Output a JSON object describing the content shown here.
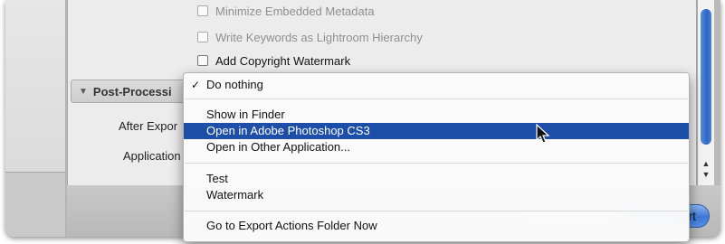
{
  "options": {
    "minimize_metadata_label": "Minimize Embedded Metadata",
    "write_keywords_label": "Write Keywords as Lightroom Hierarchy",
    "copyright_watermark_label": "Add Copyright Watermark"
  },
  "post_processing": {
    "section_title": "Post-Processi",
    "after_export_label": "After Expor",
    "application_label": "Application"
  },
  "popup_menu": {
    "items": [
      {
        "label": "Do nothing",
        "checked": true
      },
      {
        "label": "Show in Finder"
      },
      {
        "label": "Open in Adobe Photoshop CS3",
        "highlighted": true
      },
      {
        "label": "Open in Other Application..."
      },
      {
        "label": "Test"
      },
      {
        "label": "Watermark"
      },
      {
        "label": "Go to Export Actions Folder Now"
      }
    ],
    "check_glyph": "✓"
  },
  "footer": {
    "export_label": "port"
  },
  "colors": {
    "highlight": "#1d4fa8",
    "accent_button": "#3d78d8"
  },
  "icons": {
    "section_toggle": "disclosure-triangle-icon",
    "cursor": "mouse-pointer-icon",
    "scroll_up": "scroll-up-arrow-icon",
    "scroll_down": "scroll-down-arrow-icon"
  }
}
